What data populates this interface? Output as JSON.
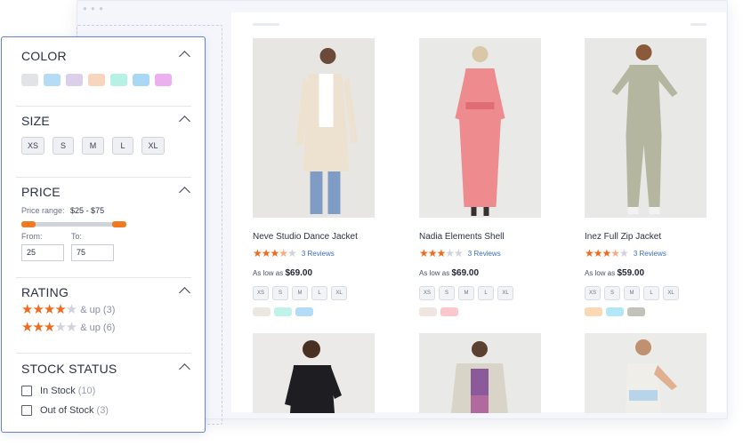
{
  "filters": {
    "color": {
      "title": "COLOR",
      "swatches": [
        "#e2e3e6",
        "#b5dcf5",
        "#dccfe9",
        "#f7d6bd",
        "#b6f1e5",
        "#a9d7f6",
        "#ecb0f1"
      ]
    },
    "size": {
      "title": "SIZE",
      "options": [
        "XS",
        "S",
        "M",
        "L",
        "XL"
      ]
    },
    "price": {
      "title": "PRICE",
      "range_label": "Price range:",
      "range_value": "$25 - $75",
      "from_label": "From:",
      "to_label": "To:",
      "from_value": "25",
      "to_value": "75"
    },
    "rating": {
      "title": "RATING",
      "options": [
        {
          "stars": 4,
          "text": "& up (3)"
        },
        {
          "stars": 3,
          "text": "& up (6)"
        }
      ]
    },
    "stock": {
      "title": "STOCK STATUS",
      "options": [
        {
          "label": "In Stock",
          "count": "(10)"
        },
        {
          "label": "Out of Stock",
          "count": "(3)"
        }
      ]
    }
  },
  "products": [
    {
      "name": "Neve Studio Dance Jacket",
      "rating": 3.5,
      "reviews": "3 Reviews",
      "price_prefix": "As low as",
      "price": "$69.00",
      "sizes": [
        "XS",
        "S",
        "M",
        "L",
        "XL"
      ],
      "colors": [
        "#ece7e0",
        "#bff3e9",
        "#b4dcf6"
      ]
    },
    {
      "name": "Nadia Elements Shell",
      "rating": 3,
      "reviews": "3 Reviews",
      "price_prefix": "As low as",
      "price": "$69.00",
      "sizes": [
        "XS",
        "S",
        "M",
        "L",
        "XL"
      ],
      "colors": [
        "#ede6e1",
        "#f9c7cc"
      ]
    },
    {
      "name": "Inez Full Zip Jacket",
      "rating": 3.5,
      "reviews": "3 Reviews",
      "price_prefix": "As low as",
      "price": "$59.00",
      "sizes": [
        "XS",
        "S",
        "M",
        "L",
        "XL"
      ],
      "colors": [
        "#fbd9b5",
        "#b2e8f5",
        "#c2c2b8"
      ]
    }
  ],
  "product_images": [
    {
      "image": "woman-beige-trench-coat",
      "bg": "#e8e6e3"
    },
    {
      "image": "woman-pink-dress",
      "bg": "#e9e9e7"
    },
    {
      "image": "woman-khaki-jumpsuit",
      "bg": "#e8e8e6"
    },
    {
      "image": "woman-black-crop-top",
      "bg": "#ebeae8"
    },
    {
      "image": "woman-cream-jacket-purple-top",
      "bg": "#e9e9e7"
    },
    {
      "image": "woman-light-blue-top",
      "bg": "#ebebe9"
    }
  ]
}
